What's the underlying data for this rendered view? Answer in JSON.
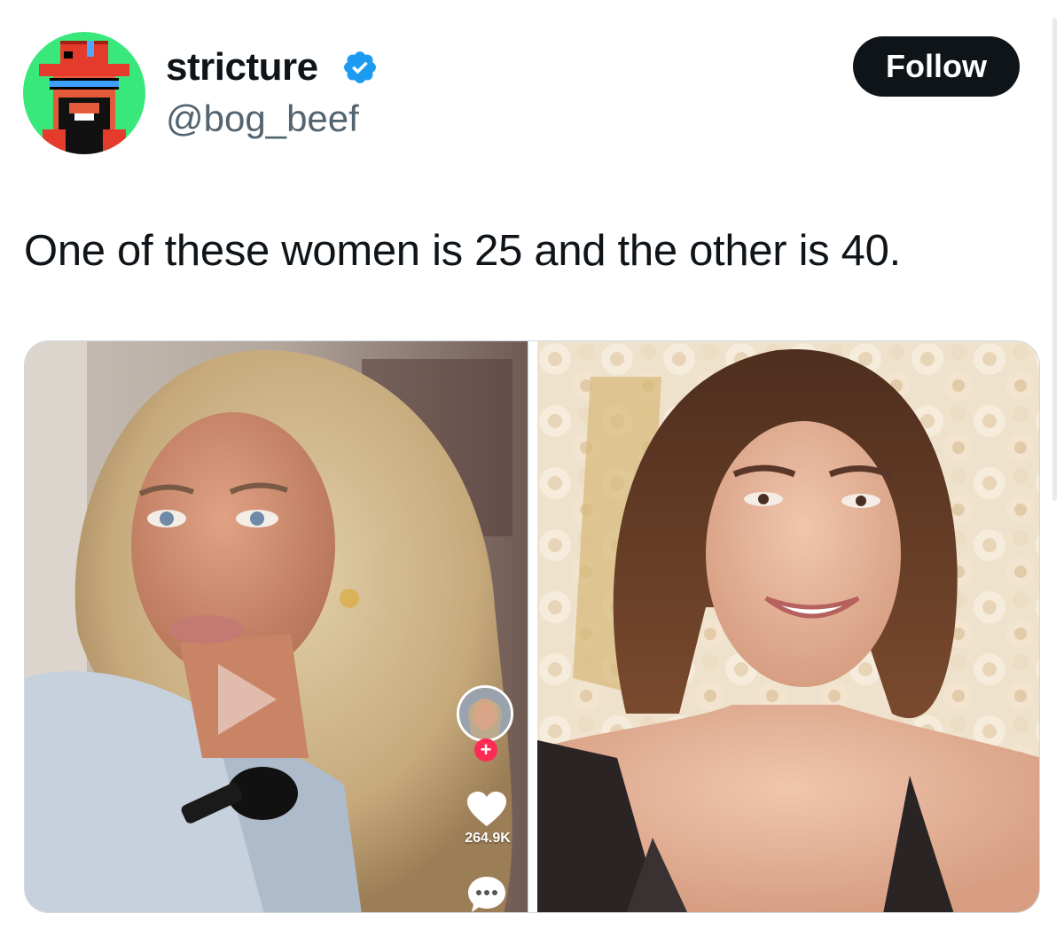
{
  "user": {
    "display_name": "stricture",
    "handle": "@bog_beef",
    "verified": true,
    "avatar_icon": "pixel-art-cowboy-avatar"
  },
  "follow_button": {
    "label": "Follow"
  },
  "tweet": {
    "text": "One of these women is 25 and the other is 40."
  },
  "media": {
    "left": {
      "kind": "video-screenshot",
      "like_count": "264.9K",
      "plus_label": "+",
      "icons": [
        "play-icon",
        "profile-avatar",
        "follow-plus-icon",
        "heart-icon",
        "comment-icon"
      ]
    },
    "right": {
      "kind": "photo"
    }
  },
  "colors": {
    "text": "#0f1419",
    "secondary_text": "#536471",
    "verified_blue": "#1d9bf0",
    "follow_bg": "#0f1419",
    "tiktok_red": "#fe2c55"
  }
}
